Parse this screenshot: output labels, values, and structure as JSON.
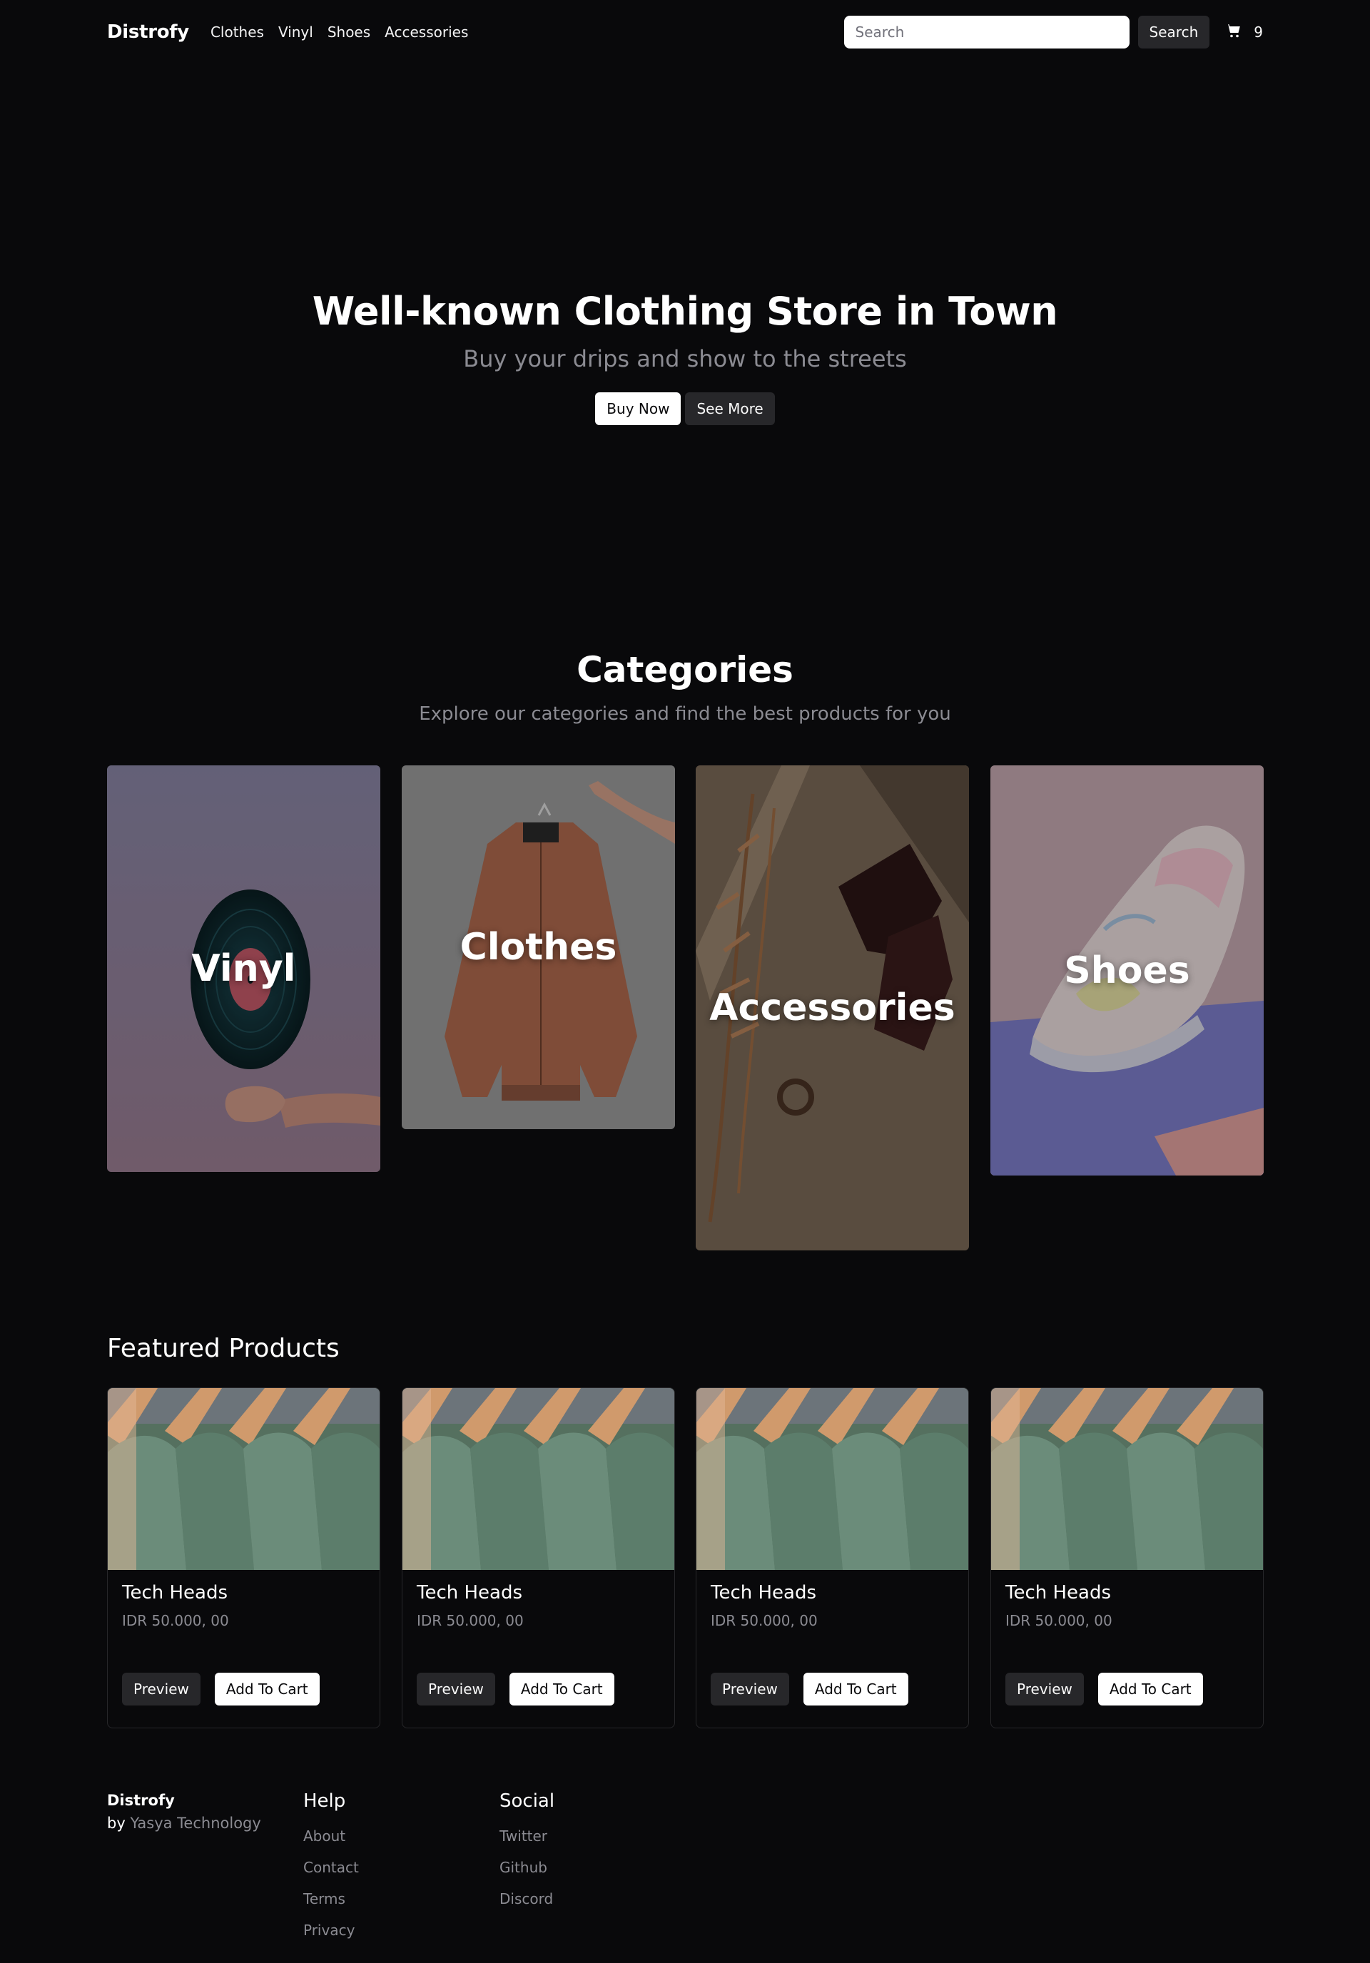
{
  "nav": {
    "brand": "Distrofy",
    "links": [
      "Clothes",
      "Vinyl",
      "Shoes",
      "Accessories"
    ],
    "search_placeholder": "Search",
    "search_button": "Search",
    "cart_count": "9",
    "cart_icon": "cart-icon"
  },
  "hero": {
    "title": "Well-known Clothing Store in Town",
    "subtitle": "Buy your drips and show to the streets",
    "buy_now": "Buy Now",
    "see_more": "See More"
  },
  "categories": {
    "title": "Categories",
    "subtitle": "Explore our categories and find the best products for you",
    "items": [
      {
        "label": "Vinyl"
      },
      {
        "label": "Clothes"
      },
      {
        "label": "Accessories"
      },
      {
        "label": "Shoes"
      }
    ]
  },
  "featured": {
    "title": "Featured Products",
    "products": [
      {
        "name": "Tech Heads",
        "price": "IDR 50.000, 00",
        "preview": "Preview",
        "add": "Add To Cart"
      },
      {
        "name": "Tech Heads",
        "price": "IDR 50.000, 00",
        "preview": "Preview",
        "add": "Add To Cart"
      },
      {
        "name": "Tech Heads",
        "price": "IDR 50.000, 00",
        "preview": "Preview",
        "add": "Add To Cart"
      },
      {
        "name": "Tech Heads",
        "price": "IDR 50.000, 00",
        "preview": "Preview",
        "add": "Add To Cart"
      }
    ]
  },
  "footer": {
    "brand": "Distrofy",
    "by": "by",
    "maker": "Yasya Technology",
    "help": {
      "title": "Help",
      "links": [
        "About",
        "Contact",
        "Terms",
        "Privacy"
      ]
    },
    "social": {
      "title": "Social",
      "links": [
        "Twitter",
        "Github",
        "Discord"
      ]
    }
  },
  "colors": {
    "background": "#09090b",
    "muted_text": "#8b8b92",
    "dark_button": "#27272a",
    "light_button": "#ffffff"
  }
}
